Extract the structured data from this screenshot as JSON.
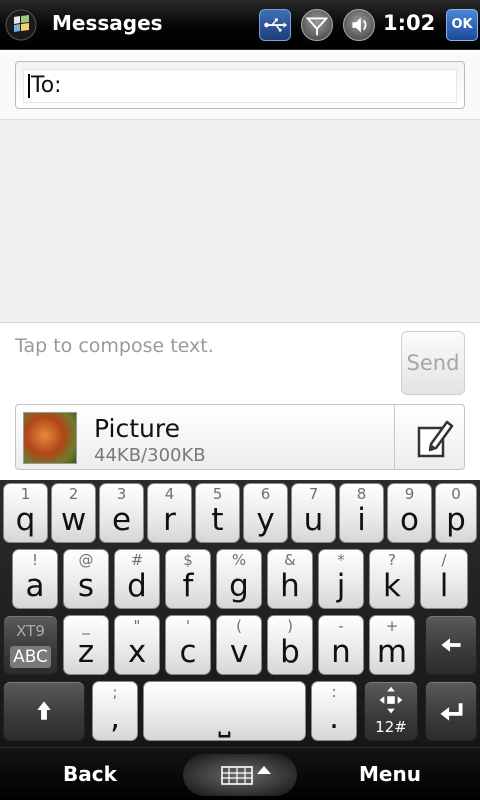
{
  "status_bar": {
    "app_title": "Messages",
    "time": "1:02",
    "ok_label": "OK",
    "icons": [
      "windows-start-icon",
      "usb-connection-icon",
      "signal-icon",
      "volume-icon"
    ]
  },
  "recipient": {
    "label": "To:"
  },
  "compose": {
    "placeholder": "Tap to compose text.",
    "send_label": "Send"
  },
  "attachment": {
    "name": "Picture",
    "size": "44KB/300KB"
  },
  "keyboard": {
    "rows": [
      [
        {
          "primary": "q",
          "secondary": "1"
        },
        {
          "primary": "w",
          "secondary": "2"
        },
        {
          "primary": "e",
          "secondary": "3"
        },
        {
          "primary": "r",
          "secondary": "4"
        },
        {
          "primary": "t",
          "secondary": "5"
        },
        {
          "primary": "y",
          "secondary": "6"
        },
        {
          "primary": "u",
          "secondary": "7"
        },
        {
          "primary": "i",
          "secondary": "8"
        },
        {
          "primary": "o",
          "secondary": "9"
        },
        {
          "primary": "p",
          "secondary": "0"
        }
      ],
      [
        {
          "primary": "a",
          "secondary": "!"
        },
        {
          "primary": "s",
          "secondary": "@"
        },
        {
          "primary": "d",
          "secondary": "#"
        },
        {
          "primary": "f",
          "secondary": "$"
        },
        {
          "primary": "g",
          "secondary": "%"
        },
        {
          "primary": "h",
          "secondary": "&"
        },
        {
          "primary": "j",
          "secondary": "*"
        },
        {
          "primary": "k",
          "secondary": "?"
        },
        {
          "primary": "l",
          "secondary": "/"
        }
      ],
      [
        {
          "primary": "z",
          "secondary": "_"
        },
        {
          "primary": "x",
          "secondary": "\""
        },
        {
          "primary": "c",
          "secondary": "'"
        },
        {
          "primary": "v",
          "secondary": "("
        },
        {
          "primary": "b",
          "secondary": ")"
        },
        {
          "primary": "n",
          "secondary": "-"
        },
        {
          "primary": "m",
          "secondary": "+"
        }
      ]
    ],
    "mode_top": "XT9",
    "mode_bottom": "ABC",
    "comma": {
      "primary": ",",
      "secondary": ";"
    },
    "period": {
      "primary": ".",
      "secondary": ":"
    },
    "space_label": "⎵",
    "numbers_label": "12#"
  },
  "soft_keys": {
    "left": "Back",
    "right": "Menu"
  }
}
